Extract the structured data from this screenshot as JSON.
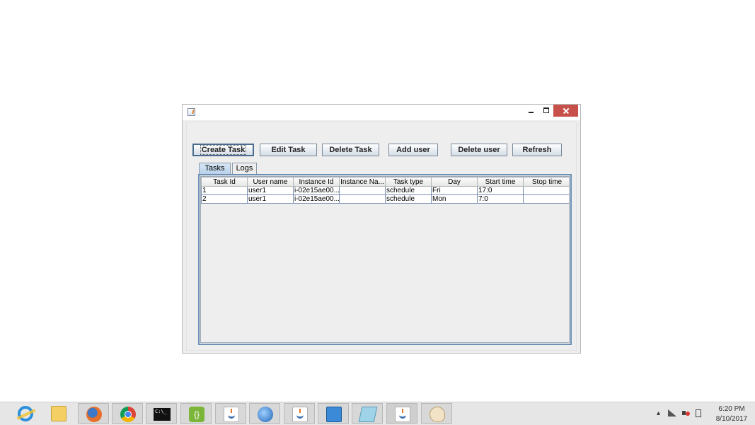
{
  "toolbar": {
    "create_task": "Create Task",
    "edit_task": "Edit Task",
    "delete_task": "Delete Task",
    "add_user": "Add user",
    "delete_user": "Delete user",
    "refresh": "Refresh"
  },
  "tabs": [
    {
      "label": "Tasks",
      "selected": true
    },
    {
      "label": "Logs",
      "selected": false
    }
  ],
  "table": {
    "columns": [
      "Task Id",
      "User name",
      "Instance Id",
      "Instance Na...",
      "Task type",
      "Day",
      "Start time",
      "Stop time"
    ],
    "rows": [
      [
        "1",
        "user1",
        "i-02e15ae00...",
        "",
        "schedule",
        "Fri",
        "17:0",
        ""
      ],
      [
        "2",
        "user1",
        "i-02e15ae00...",
        "",
        "schedule",
        "Mon",
        "7:0",
        ""
      ]
    ]
  },
  "taskbar": {
    "items": [
      {
        "icon": "internet-explorer-icon",
        "active": false
      },
      {
        "icon": "file-explorer-icon",
        "active": false
      },
      {
        "icon": "firefox-icon",
        "active": false
      },
      {
        "icon": "chrome-icon",
        "active": false
      },
      {
        "icon": "command-prompt-icon",
        "active": false
      },
      {
        "icon": "brackets-icon",
        "active": false
      },
      {
        "icon": "java-icon",
        "active": false
      },
      {
        "icon": "browser-icon",
        "active": false
      },
      {
        "icon": "java-icon",
        "active": false
      },
      {
        "icon": "remote-desktop-icon",
        "active": false
      },
      {
        "icon": "notepad-icon",
        "active": false
      },
      {
        "icon": "java-icon",
        "active": true
      },
      {
        "icon": "paint-icon",
        "active": false
      }
    ],
    "clock": {
      "time": "6:20 PM",
      "date": "8/10/2017"
    },
    "brackets_glyph": "{}"
  }
}
